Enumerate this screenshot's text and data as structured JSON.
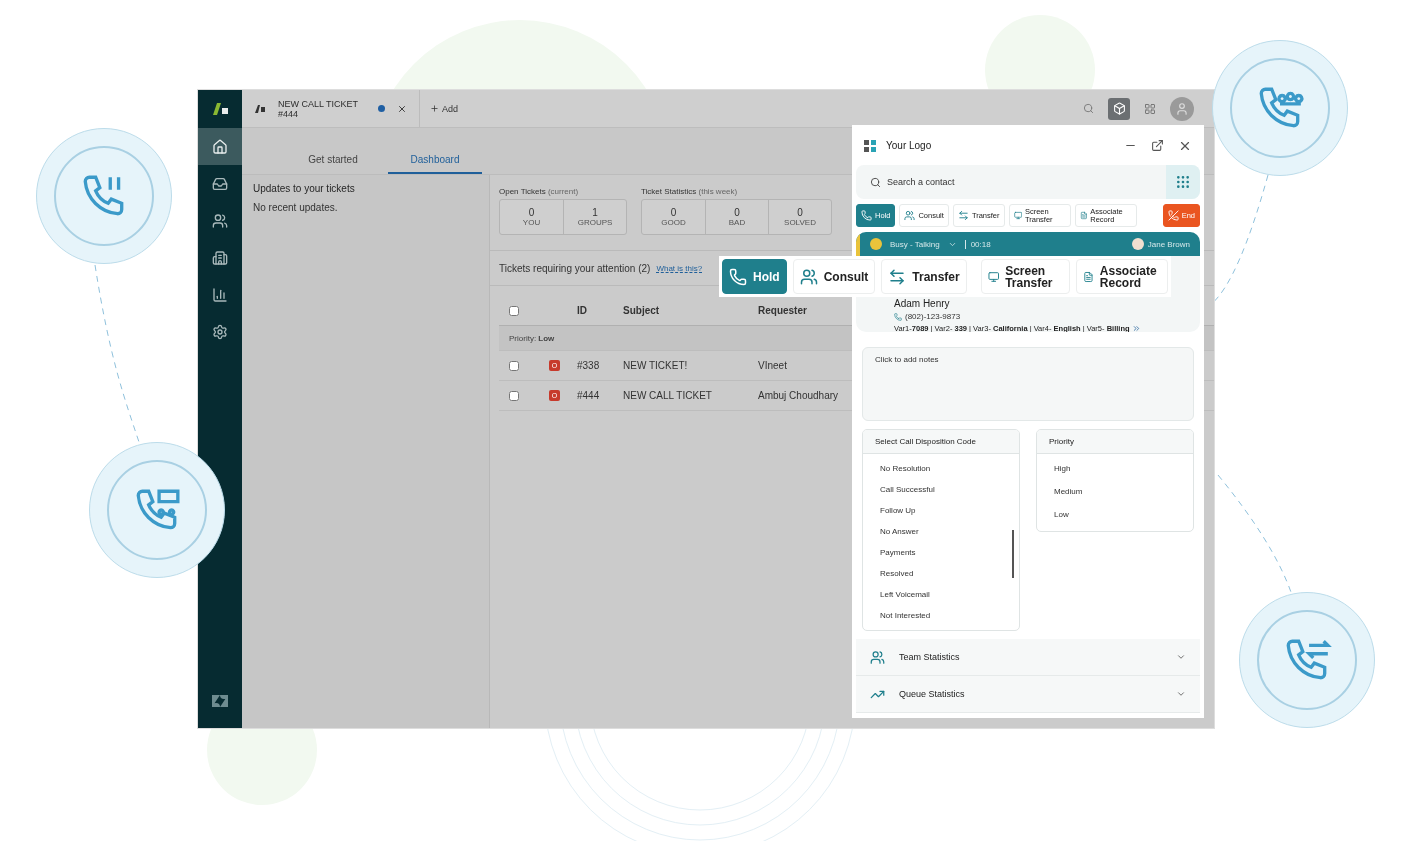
{
  "app_tab": {
    "title": "NEW CALL TICKET",
    "subtitle": "#444",
    "unsaved": true
  },
  "add_label": "Add",
  "nav": [
    {
      "kind": "home",
      "selected": true
    },
    {
      "kind": "inbox",
      "selected": false
    },
    {
      "kind": "users",
      "selected": false
    },
    {
      "kind": "building",
      "selected": false
    },
    {
      "kind": "chart",
      "selected": false
    },
    {
      "kind": "settings",
      "selected": false
    }
  ],
  "page_tabs": [
    {
      "label": "Get started",
      "selected": false
    },
    {
      "label": "Dashboard",
      "selected": true
    }
  ],
  "updates": {
    "title": "Updates to your tickets",
    "text": "No recent updates."
  },
  "stat_groups": [
    {
      "title": "Open Tickets",
      "note": "(current)",
      "stats": [
        {
          "value": "0",
          "label": "YOU"
        },
        {
          "value": "1",
          "label": "GROUPS"
        }
      ]
    },
    {
      "title": "Ticket Statistics",
      "note": "(this week)",
      "stats": [
        {
          "value": "0",
          "label": "GOOD"
        },
        {
          "value": "0",
          "label": "BAD"
        },
        {
          "value": "0",
          "label": "SOLVED"
        }
      ]
    }
  ],
  "attention": {
    "title": "Tickets requiring your attention (2)",
    "link": "What is this?"
  },
  "table": {
    "all_checked": false,
    "columns": [
      "ID",
      "Subject",
      "Requester"
    ],
    "group": "Priority: **Low**",
    "rows": [
      {
        "checked": false,
        "status": "O",
        "id": "#338",
        "subject": "NEW TICKET!",
        "requester": "VIneet"
      },
      {
        "checked": false,
        "status": "O",
        "id": "#444",
        "subject": "NEW CALL TICKET",
        "requester": "Ambuj Choudhary"
      }
    ]
  },
  "widget": {
    "logo": "Your Logo",
    "search": {
      "placeholder": "Search a contact"
    },
    "actions": [
      {
        "kind": "hold",
        "label": "Hold",
        "selected": true
      },
      {
        "kind": "consult",
        "label": "Consult",
        "selected": false
      },
      {
        "kind": "transfer",
        "label": "Transfer",
        "selected": false
      },
      {
        "kind": "screen",
        "label": "Screen Transfer",
        "selected": false
      },
      {
        "kind": "record",
        "label": "Associate Record",
        "selected": false
      },
      {
        "kind": "end",
        "label": "End"
      }
    ],
    "status": {
      "label": "Busy - Talking",
      "timer": "00:18",
      "agent": "Jane Brown"
    },
    "contact": {
      "name": "Adam Henry",
      "phone": "(802)-123-9873",
      "vars": "Var1-**7089** | Var2- **339** | Var3- **California** | Var4- **English** | Var5- **Billing**"
    },
    "notes": {
      "placeholder": "Click to add notes"
    },
    "disposition": {
      "title": "Select Call Disposition Code",
      "options": [
        "No Resolution",
        "Call Successful",
        "Follow Up",
        "No Answer",
        "Payments",
        "Resolved",
        "Left Voicemail",
        "Not Interested"
      ]
    },
    "priority": {
      "title": "Priority",
      "options": [
        "High",
        "Medium",
        "Low"
      ]
    },
    "sections": [
      {
        "kind": "team",
        "label": "Team Statistics",
        "expanded": false
      },
      {
        "kind": "queue",
        "label": "Queue Statistics",
        "expanded": false
      }
    ]
  },
  "callout_actions": [
    {
      "kind": "hold",
      "label": "Hold",
      "selected": true
    },
    {
      "kind": "consult",
      "label": "Consult",
      "selected": false
    },
    {
      "kind": "transfer",
      "label": "Transfer",
      "selected": false
    },
    {
      "kind": "screen",
      "label": "Screen Transfer",
      "selected": false
    },
    {
      "kind": "record",
      "label": "Associate Record",
      "selected": false
    }
  ]
}
